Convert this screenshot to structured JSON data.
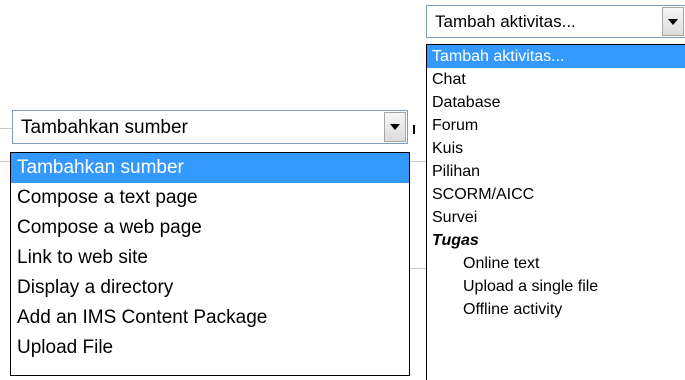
{
  "resource_dropdown": {
    "selected": "Tambahkan sumber",
    "options": [
      "Tambahkan sumber",
      "Compose a text page",
      "Compose a web page",
      "Link to web site",
      "Display a directory",
      "Add an IMS Content Package",
      "Upload File"
    ],
    "highlighted_index": 0
  },
  "activity_dropdown": {
    "selected": "Tambah aktivitas...",
    "options": [
      "Tambah aktivitas...",
      "Chat",
      "Database",
      "Forum",
      "Kuis",
      "Pilihan",
      "SCORM/AICC",
      "Survei"
    ],
    "group_label": "Tugas",
    "group_options": [
      "Online text",
      "Upload a single file",
      "Offline activity"
    ],
    "highlighted_index": 0
  },
  "icons": {
    "dropdown_arrow": "chevron-down-icon"
  },
  "colors": {
    "highlight": "#3399ff",
    "select_border": "#7f9db9"
  }
}
